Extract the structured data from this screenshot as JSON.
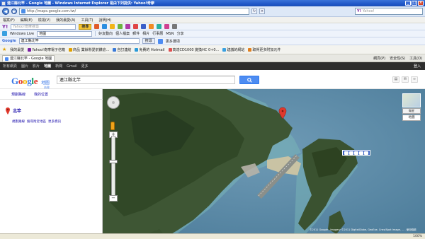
{
  "window": {
    "title": "連江縣北竿 - Google 地圖 - Windows Internet Explorer 是由下列提供: Yahoo!奇摩",
    "minimize": "_",
    "maximize": "□",
    "close": "×"
  },
  "address_bar": {
    "url": "http://maps.google.com.tw/",
    "search_placeholder": "Yahoo!"
  },
  "menu": [
    "檔案(F)",
    "編輯(E)",
    "檢視(V)",
    "我的最愛(A)",
    "工具(T)",
    "說明(H)"
  ],
  "yahoo_toolbar": {
    "logo": "Y!",
    "search_placeholder": "Yahoo!奇摩搜尋",
    "search_button": "搜尋"
  },
  "live_toolbar": {
    "label": "Windows Live",
    "box_text": "地圖",
    "items": [
      "好友動向",
      "個人檔案",
      "郵件",
      "相片",
      "行事曆",
      "MSN",
      "分享"
    ]
  },
  "google_toolbar": {
    "label": "Google",
    "query": "連江縣北竿",
    "search_button": "搜尋",
    "more": "更多選項"
  },
  "favorites": {
    "label": "我的最愛",
    "items": [
      "Yahoo!奇摩電子信箱",
      "商品 業餘懸愛前鑽倉...",
      "自訂連結",
      "免費的 Hotmail",
      "高達CD1000 變換HC 0+0...",
      "建議的網站",
      "取得更多附加元件"
    ]
  },
  "tab": {
    "label": "連江縣北竿 - Google 地圖"
  },
  "tab_tools": [
    "網頁(P)",
    "安全性(S)",
    "工具(O)"
  ],
  "gbar": {
    "items": [
      "所有網頁",
      "圖片",
      "影片",
      "地圖",
      "新聞",
      "Gmail",
      "更多"
    ],
    "active_index": 3,
    "login": "登入"
  },
  "maps_header": {
    "logo": "Google",
    "logo_suffix": "地圖",
    "logo_region": "台灣",
    "query": "連江縣北竿"
  },
  "sidebar": {
    "links": [
      "規劃路線",
      "我的位置"
    ],
    "result_title": "北竿",
    "result_actions": [
      "規劃路線",
      "搜尋附近地區",
      "更多資訊"
    ]
  },
  "map": {
    "mini_label_top": "衛星",
    "mini_label": "地圖",
    "copyright": "©2011 Google - Imagery ©2011 DigitalGlobe, GeoEye, Cnes/Spot Image, ... - 使用條款"
  },
  "status": {
    "left": "",
    "zoom": "100%"
  },
  "colors": {
    "accent": "#4d8cf2",
    "titlebar": "#2158c8",
    "sea": "#5a8aa8"
  }
}
